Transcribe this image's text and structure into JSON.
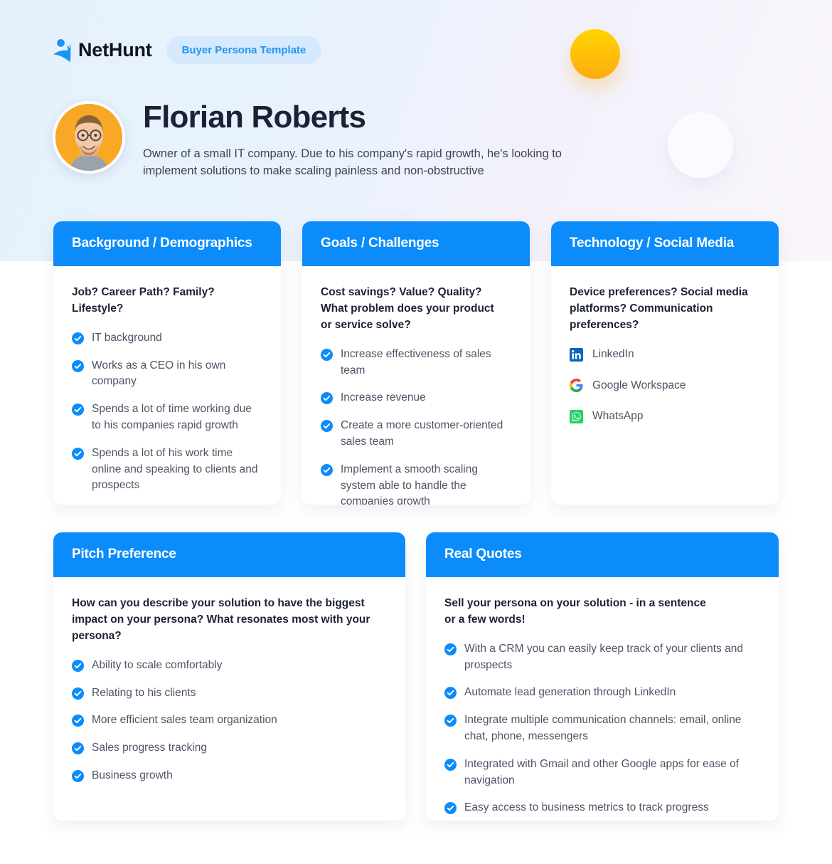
{
  "brand": {
    "logo_icon": "nethunt-logo-icon",
    "name_part1": "Net",
    "name_part2": "Hunt",
    "badge_label": "Buyer Persona Template"
  },
  "persona": {
    "avatar_icon": "persona-avatar-photo",
    "name": "Florian Roberts",
    "description": "Owner of a small IT company. Due to his company's rapid growth, he's looking to implement solutions to make scaling painless and non-obstructive"
  },
  "colors": {
    "accent_blue": "#0c8cfa",
    "badge_bg": "#d6e9fd",
    "badge_text": "#2196f3",
    "heading_dark": "#1b2235",
    "body_text": "#4c5565",
    "hero_left": "#e4f1fd",
    "hero_right": "#fbf6fc",
    "avatar_bg": "#f9a825",
    "deco_yellow_top": "#ffd500",
    "deco_yellow_bottom": "#fcab12"
  },
  "cards": [
    {
      "id": "background-demographics",
      "title": "Background / Demographics",
      "question": "Job? Career Path? Family? Lifestyle?",
      "items": [
        "IT background",
        "Works as a CEO in his own company",
        "Spends a lot of time working due to his companies rapid growth",
        "Spends a lot of his work time online and speaking to clients and prospects"
      ]
    },
    {
      "id": "goals-challenges",
      "title": "Goals / Challenges",
      "question": "Cost savings? Value? Quality?\nWhat problem does your product\nor service solve?",
      "items": [
        "Increase effectiveness of sales team",
        "Increase revenue",
        "Create a more customer-oriented sales team",
        "Implement a smooth scaling system able to handle the companies growth"
      ]
    },
    {
      "id": "technology-social-media",
      "title": "Technology / Social Media",
      "question": "Device preferences? Social media platforms? Communication preferences?",
      "social": [
        {
          "label": "LinkedIn",
          "icon": "linkedin-icon"
        },
        {
          "label": "Google Workspace",
          "icon": "google-icon"
        },
        {
          "label": "WhatsApp",
          "icon": "whatsapp-icon"
        }
      ]
    },
    {
      "id": "pitch-preference",
      "title": "Pitch Preference",
      "question": "How can you describe your solution to have the biggest impact on your persona? What resonates most with your persona?",
      "items": [
        "Ability to scale comfortably",
        "Relating to his clients",
        "More efficient sales team organization",
        "Sales progress tracking",
        "Business growth"
      ]
    },
    {
      "id": "real-quotes",
      "title": "Real Quotes",
      "question": "Sell your persona on your solution - in a sentence\nor a few words!",
      "items": [
        "With a CRM you can easily keep track of your clients and prospects",
        "Automate lead generation through LinkedIn",
        "Integrate multiple communication channels: email, online chat, phone, messengers",
        "Integrated with Gmail and other Google apps for ease of navigation",
        "Easy access to business metrics to track progress"
      ]
    }
  ]
}
